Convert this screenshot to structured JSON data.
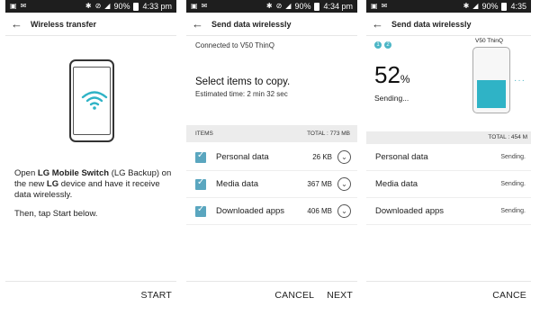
{
  "status_bars": [
    {
      "time": "4:33 pm",
      "battery": "90%"
    },
    {
      "time": "4:34 pm",
      "battery": "90%"
    },
    {
      "time": "4:35",
      "battery": "90%"
    }
  ],
  "screen1": {
    "title": "Wireless transfer",
    "instruction_pre": "Open ",
    "instruction_app": "LG Mobile Switch",
    "instruction_mid": " (LG Backup) on the new ",
    "instruction_device": "LG",
    "instruction_post": " device and have it receive data wirelessly.",
    "instruction2": "Then, tap Start below.",
    "start_label": "START",
    "icons": {
      "phone": "phone-wifi-illustration",
      "wifi": "wifi-icon"
    }
  },
  "screen2": {
    "title": "Send data wirelessly",
    "connected": "Connected to V50 ThinQ",
    "select_title": "Select items to copy.",
    "estimated": "Estimated time: 2 min 32 sec",
    "items_header": "ITEMS",
    "total": "TOTAL : 773 MB",
    "rows": [
      {
        "label": "Personal data",
        "size": "26 KB",
        "checked": true
      },
      {
        "label": "Media data",
        "size": "367 MB",
        "checked": true
      },
      {
        "label": "Downloaded apps",
        "size": "406 MB",
        "checked": true
      }
    ],
    "cancel_label": "CANCEL",
    "next_label": "NEXT"
  },
  "screen3": {
    "title": "Send data wirelessly",
    "steps": [
      "1",
      "2"
    ],
    "target_device": "V50 ThinQ",
    "percent_value": "52",
    "percent_sign": "%",
    "progress_fraction": 0.52,
    "status": "Sending...",
    "total": "TOTAL : 454 M",
    "rows": [
      {
        "label": "Personal data",
        "status": "Sending."
      },
      {
        "label": "Media data",
        "status": "Sending."
      },
      {
        "label": "Downloaded apps",
        "status": "Sending."
      }
    ],
    "cancel_label": "CANCE"
  },
  "colors": {
    "accent": "#2fb3c6",
    "checkbox": "#5aa6bf",
    "statusbar": "#1e1e1e"
  }
}
